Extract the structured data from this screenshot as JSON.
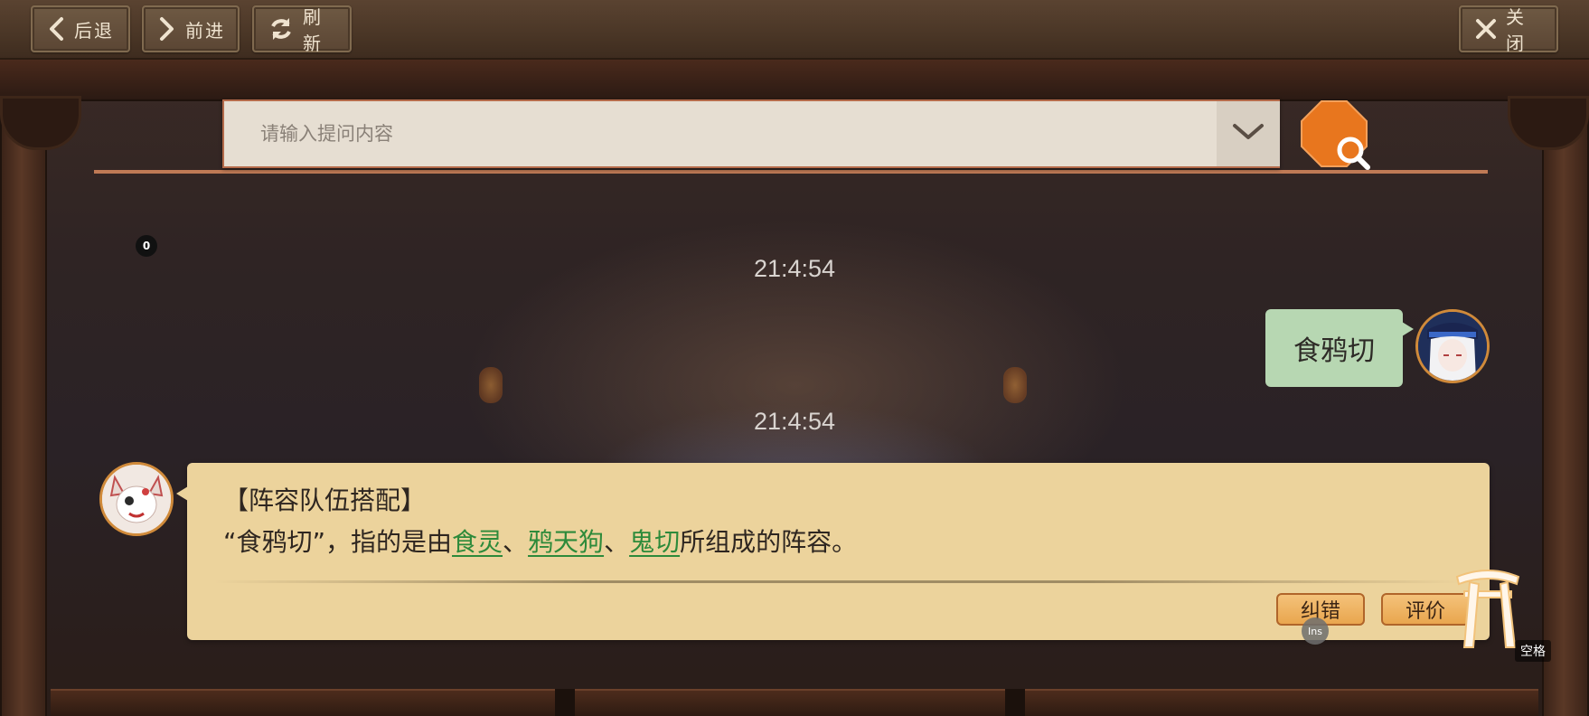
{
  "toolbar": {
    "back_label": "后退",
    "forward_label": "前进",
    "refresh_label": "刷新",
    "close_label": "关闭"
  },
  "search": {
    "placeholder": "请输入提问内容",
    "value": ""
  },
  "badge_count": "0",
  "messages": {
    "timestamp_1": "21:4:54",
    "user_text": "食鸦切",
    "timestamp_2": "21:4:54",
    "bot_title": "【阵容队伍搭配】",
    "bot_prefix": "“食鸦切”，指的是由",
    "link_1": "食灵",
    "sep_1": "、",
    "link_2": "鸦天狗",
    "sep_2": "、",
    "link_3": "鬼切",
    "bot_suffix": "所组成的阵容。"
  },
  "actions": {
    "correct_label": "纠错",
    "rate_label": "评价"
  },
  "hotkeys": {
    "ins_label": "Ins",
    "space_label": "空格"
  },
  "colors": {
    "accent": "#e8761e",
    "link": "#2d8a3a",
    "bot_bubble": "#ecd39c",
    "user_bubble": "#b7d7b2"
  },
  "icons": {
    "back": "chevron-left-icon",
    "forward": "chevron-right-icon",
    "refresh": "refresh-icon",
    "close": "close-icon",
    "dropdown": "chevron-down-icon",
    "search": "search-icon",
    "torii": "torii-gate-icon"
  }
}
